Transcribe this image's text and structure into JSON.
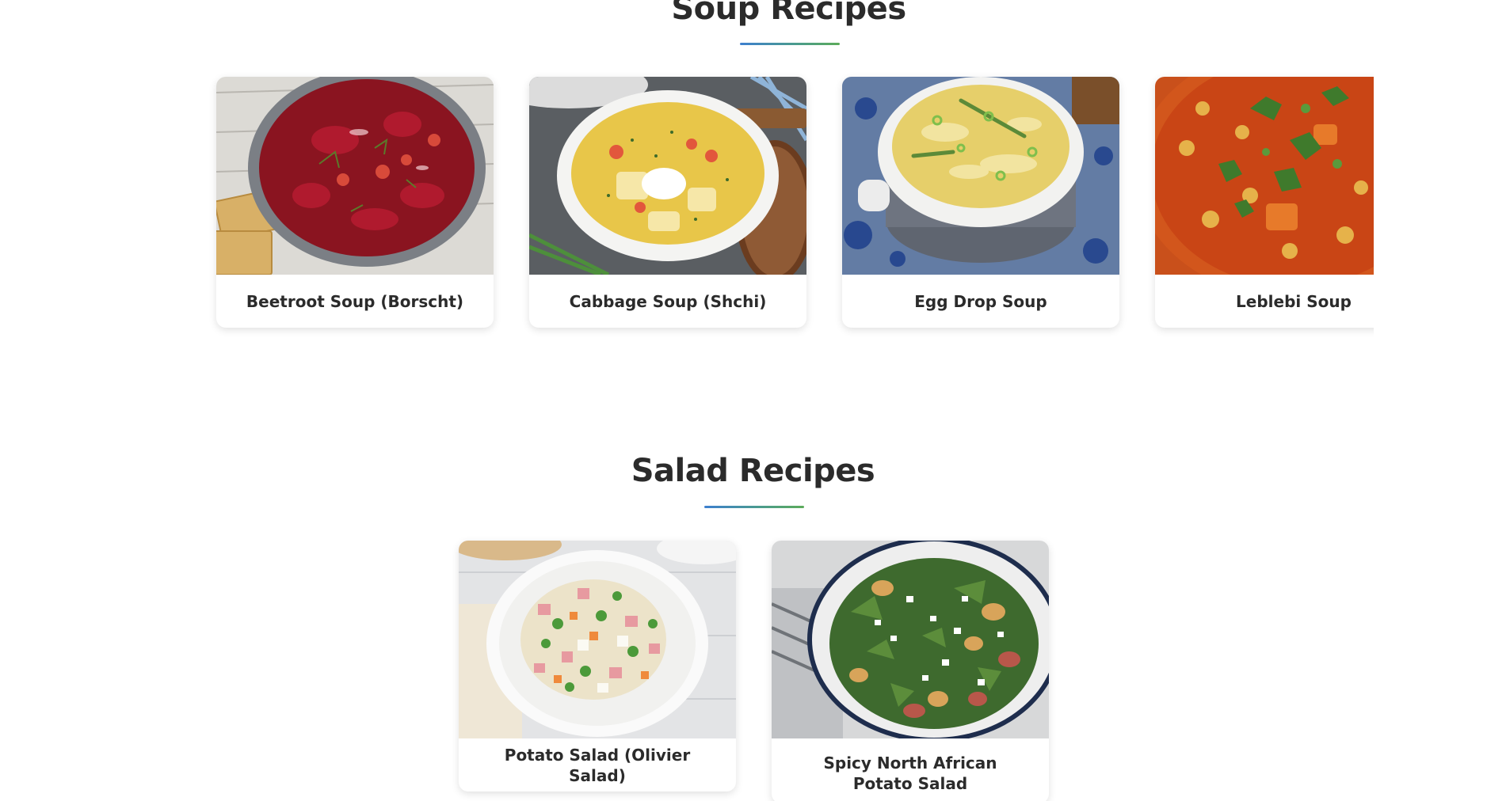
{
  "soup_section": {
    "title": "Soup Recipes",
    "cards": [
      {
        "label": "Beetroot Soup (Borscht)",
        "image_icon": "beetroot-soup-photo"
      },
      {
        "label": "Cabbage Soup (Shchi)",
        "image_icon": "cabbage-soup-photo"
      },
      {
        "label": "Egg Drop Soup",
        "image_icon": "egg-drop-soup-photo"
      },
      {
        "label": "Leblebi Soup",
        "image_icon": "leblebi-soup-photo"
      }
    ]
  },
  "salad_section": {
    "title": "Salad Recipes",
    "cards": [
      {
        "label": "Potato Salad (Olivier Salad)",
        "image_icon": "olivier-salad-photo"
      },
      {
        "label": "Spicy North African Potato Salad",
        "image_icon": "north-african-potato-salad-photo"
      }
    ]
  },
  "colors": {
    "heading": "#2b2b2b",
    "underline_start": "#3d7fcf",
    "underline_end": "#5cab5a",
    "card_background": "#ffffff"
  }
}
